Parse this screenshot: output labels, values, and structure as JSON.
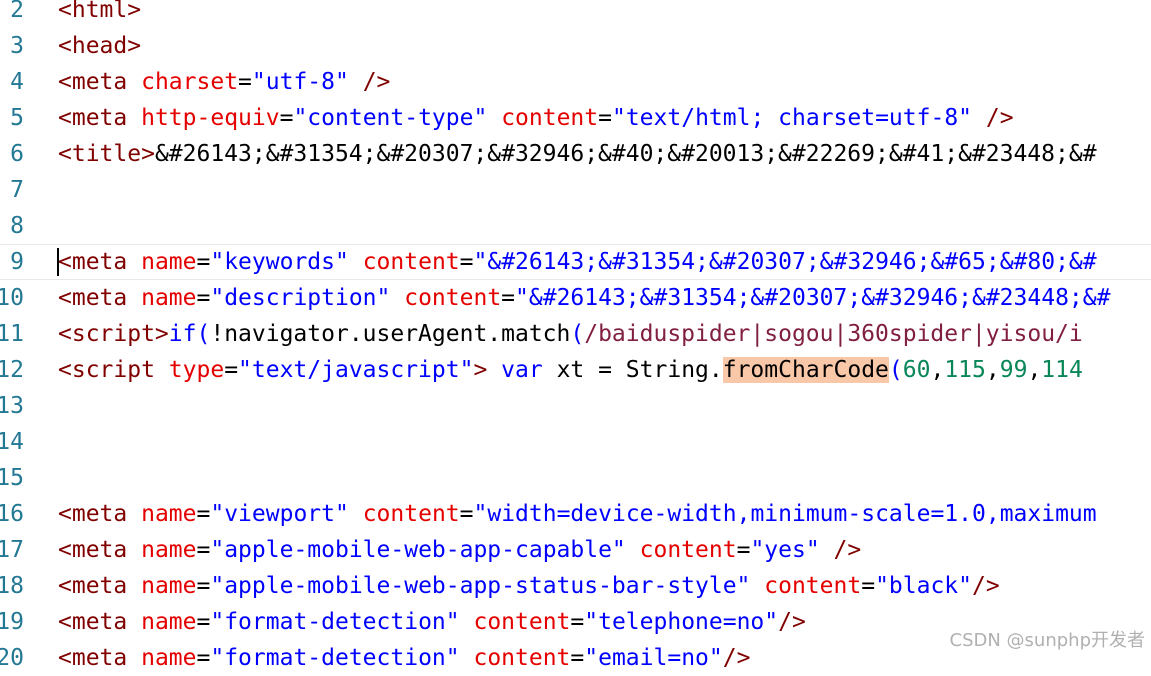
{
  "editor": {
    "lines": [
      {
        "num": "2",
        "tokens": [
          {
            "t": "<html>",
            "c": "tag"
          }
        ]
      },
      {
        "num": "3",
        "tokens": [
          {
            "t": "<head>",
            "c": "tag"
          }
        ]
      },
      {
        "num": "4",
        "tokens": [
          {
            "t": "<meta",
            "c": "tag"
          },
          {
            "t": " ",
            "c": "plain"
          },
          {
            "t": "charset",
            "c": "attr"
          },
          {
            "t": "=",
            "c": "plain"
          },
          {
            "t": "\"utf-8\"",
            "c": "val"
          },
          {
            "t": " ",
            "c": "plain"
          },
          {
            "t": "/>",
            "c": "tag"
          }
        ]
      },
      {
        "num": "5",
        "tokens": [
          {
            "t": "<meta",
            "c": "tag"
          },
          {
            "t": " ",
            "c": "plain"
          },
          {
            "t": "http-equiv",
            "c": "attr"
          },
          {
            "t": "=",
            "c": "plain"
          },
          {
            "t": "\"content-type\"",
            "c": "val"
          },
          {
            "t": " ",
            "c": "plain"
          },
          {
            "t": "content",
            "c": "attr"
          },
          {
            "t": "=",
            "c": "plain"
          },
          {
            "t": "\"text/html; charset=utf-8\"",
            "c": "val"
          },
          {
            "t": " ",
            "c": "plain"
          },
          {
            "t": "/>",
            "c": "tag"
          }
        ]
      },
      {
        "num": "6",
        "tokens": [
          {
            "t": "<title>",
            "c": "tag"
          },
          {
            "t": "&#26143;&#31354;&#20307;&#32946;&#40;&#20013;&#22269;&#41;&#23448;&#",
            "c": "plain"
          }
        ]
      },
      {
        "num": "7",
        "tokens": []
      },
      {
        "num": "8",
        "tokens": []
      },
      {
        "num": "9",
        "current": true,
        "tokens": [
          {
            "t": "<meta",
            "c": "tag"
          },
          {
            "t": " ",
            "c": "plain"
          },
          {
            "t": "name",
            "c": "attr"
          },
          {
            "t": "=",
            "c": "plain"
          },
          {
            "t": "\"keywords\"",
            "c": "val"
          },
          {
            "t": " ",
            "c": "plain"
          },
          {
            "t": "content",
            "c": "attr"
          },
          {
            "t": "=",
            "c": "plain"
          },
          {
            "t": "\"&#26143;&#31354;&#20307;&#32946;&#65;&#80;&#",
            "c": "val"
          }
        ]
      },
      {
        "num": "10",
        "tokens": [
          {
            "t": "<meta",
            "c": "tag"
          },
          {
            "t": " ",
            "c": "plain"
          },
          {
            "t": "name",
            "c": "attr"
          },
          {
            "t": "=",
            "c": "plain"
          },
          {
            "t": "\"description\"",
            "c": "val"
          },
          {
            "t": " ",
            "c": "plain"
          },
          {
            "t": "content",
            "c": "attr"
          },
          {
            "t": "=",
            "c": "plain"
          },
          {
            "t": "\"&#26143;&#31354;&#20307;&#32946;&#23448;&#",
            "c": "val"
          }
        ]
      },
      {
        "num": "11",
        "tokens": [
          {
            "t": "<script>",
            "c": "tag"
          },
          {
            "t": "if",
            "c": "kw"
          },
          {
            "t": "(",
            "c": "kw"
          },
          {
            "t": "!navigator.userAgent.match",
            "c": "plain"
          },
          {
            "t": "(",
            "c": "kw"
          },
          {
            "t": "/baiduspider|sogou|360spider|yisou/i",
            "c": "regex"
          }
        ]
      },
      {
        "num": "12",
        "tokens": [
          {
            "t": "<script",
            "c": "tag"
          },
          {
            "t": " ",
            "c": "plain"
          },
          {
            "t": "type",
            "c": "attr"
          },
          {
            "t": "=",
            "c": "plain"
          },
          {
            "t": "\"text/javascript\"",
            "c": "val"
          },
          {
            "t": ">",
            "c": "tag"
          },
          {
            "t": " ",
            "c": "plain"
          },
          {
            "t": "var",
            "c": "kw"
          },
          {
            "t": " xt = String.",
            "c": "plain"
          },
          {
            "t": "fromCharCode",
            "c": "plain hl"
          },
          {
            "t": "(",
            "c": "kw"
          },
          {
            "t": "60",
            "c": "num"
          },
          {
            "t": ",",
            "c": "plain"
          },
          {
            "t": "115",
            "c": "num"
          },
          {
            "t": ",",
            "c": "plain"
          },
          {
            "t": "99",
            "c": "num"
          },
          {
            "t": ",",
            "c": "plain"
          },
          {
            "t": "114",
            "c": "num"
          }
        ]
      },
      {
        "num": "13",
        "tokens": []
      },
      {
        "num": "14",
        "tokens": []
      },
      {
        "num": "15",
        "tokens": []
      },
      {
        "num": "16",
        "tokens": [
          {
            "t": "<meta",
            "c": "tag"
          },
          {
            "t": " ",
            "c": "plain"
          },
          {
            "t": "name",
            "c": "attr"
          },
          {
            "t": "=",
            "c": "plain"
          },
          {
            "t": "\"viewport\"",
            "c": "val"
          },
          {
            "t": " ",
            "c": "plain"
          },
          {
            "t": "content",
            "c": "attr"
          },
          {
            "t": "=",
            "c": "plain"
          },
          {
            "t": "\"width=device-width,minimum-scale=1.0,maximum",
            "c": "val"
          }
        ]
      },
      {
        "num": "17",
        "tokens": [
          {
            "t": "<meta",
            "c": "tag"
          },
          {
            "t": " ",
            "c": "plain"
          },
          {
            "t": "name",
            "c": "attr"
          },
          {
            "t": "=",
            "c": "plain"
          },
          {
            "t": "\"apple-mobile-web-app-capable\"",
            "c": "val"
          },
          {
            "t": " ",
            "c": "plain"
          },
          {
            "t": "content",
            "c": "attr"
          },
          {
            "t": "=",
            "c": "plain"
          },
          {
            "t": "\"yes\"",
            "c": "val"
          },
          {
            "t": " ",
            "c": "plain"
          },
          {
            "t": "/>",
            "c": "tag"
          }
        ]
      },
      {
        "num": "18",
        "tokens": [
          {
            "t": "<meta",
            "c": "tag"
          },
          {
            "t": " ",
            "c": "plain"
          },
          {
            "t": "name",
            "c": "attr"
          },
          {
            "t": "=",
            "c": "plain"
          },
          {
            "t": "\"apple-mobile-web-app-status-bar-style\"",
            "c": "val"
          },
          {
            "t": " ",
            "c": "plain"
          },
          {
            "t": "content",
            "c": "attr"
          },
          {
            "t": "=",
            "c": "plain"
          },
          {
            "t": "\"black\"",
            "c": "val"
          },
          {
            "t": "/>",
            "c": "tag"
          }
        ]
      },
      {
        "num": "19",
        "tokens": [
          {
            "t": "<meta",
            "c": "tag"
          },
          {
            "t": " ",
            "c": "plain"
          },
          {
            "t": "name",
            "c": "attr"
          },
          {
            "t": "=",
            "c": "plain"
          },
          {
            "t": "\"format-detection\"",
            "c": "val"
          },
          {
            "t": " ",
            "c": "plain"
          },
          {
            "t": "content",
            "c": "attr"
          },
          {
            "t": "=",
            "c": "plain"
          },
          {
            "t": "\"telephone=no\"",
            "c": "val"
          },
          {
            "t": "/>",
            "c": "tag"
          }
        ]
      },
      {
        "num": "20",
        "tokens": [
          {
            "t": "<meta",
            "c": "tag"
          },
          {
            "t": " ",
            "c": "plain"
          },
          {
            "t": "name",
            "c": "attr"
          },
          {
            "t": "=",
            "c": "plain"
          },
          {
            "t": "\"format-detection\"",
            "c": "val"
          },
          {
            "t": " ",
            "c": "plain"
          },
          {
            "t": "content",
            "c": "attr"
          },
          {
            "t": "=",
            "c": "plain"
          },
          {
            "t": "\"email=no\"",
            "c": "val"
          },
          {
            "t": "/>",
            "c": "tag"
          }
        ]
      }
    ]
  },
  "watermark": "CSDN @sunphp开发者",
  "colors": {
    "tag": "#800000",
    "attribute": "#e50000",
    "string": "#0000ff",
    "keyword": "#0000ff",
    "regex": "#811f3f",
    "number": "#098658",
    "line_number": "#237893",
    "highlight": "#f8c8a8"
  }
}
